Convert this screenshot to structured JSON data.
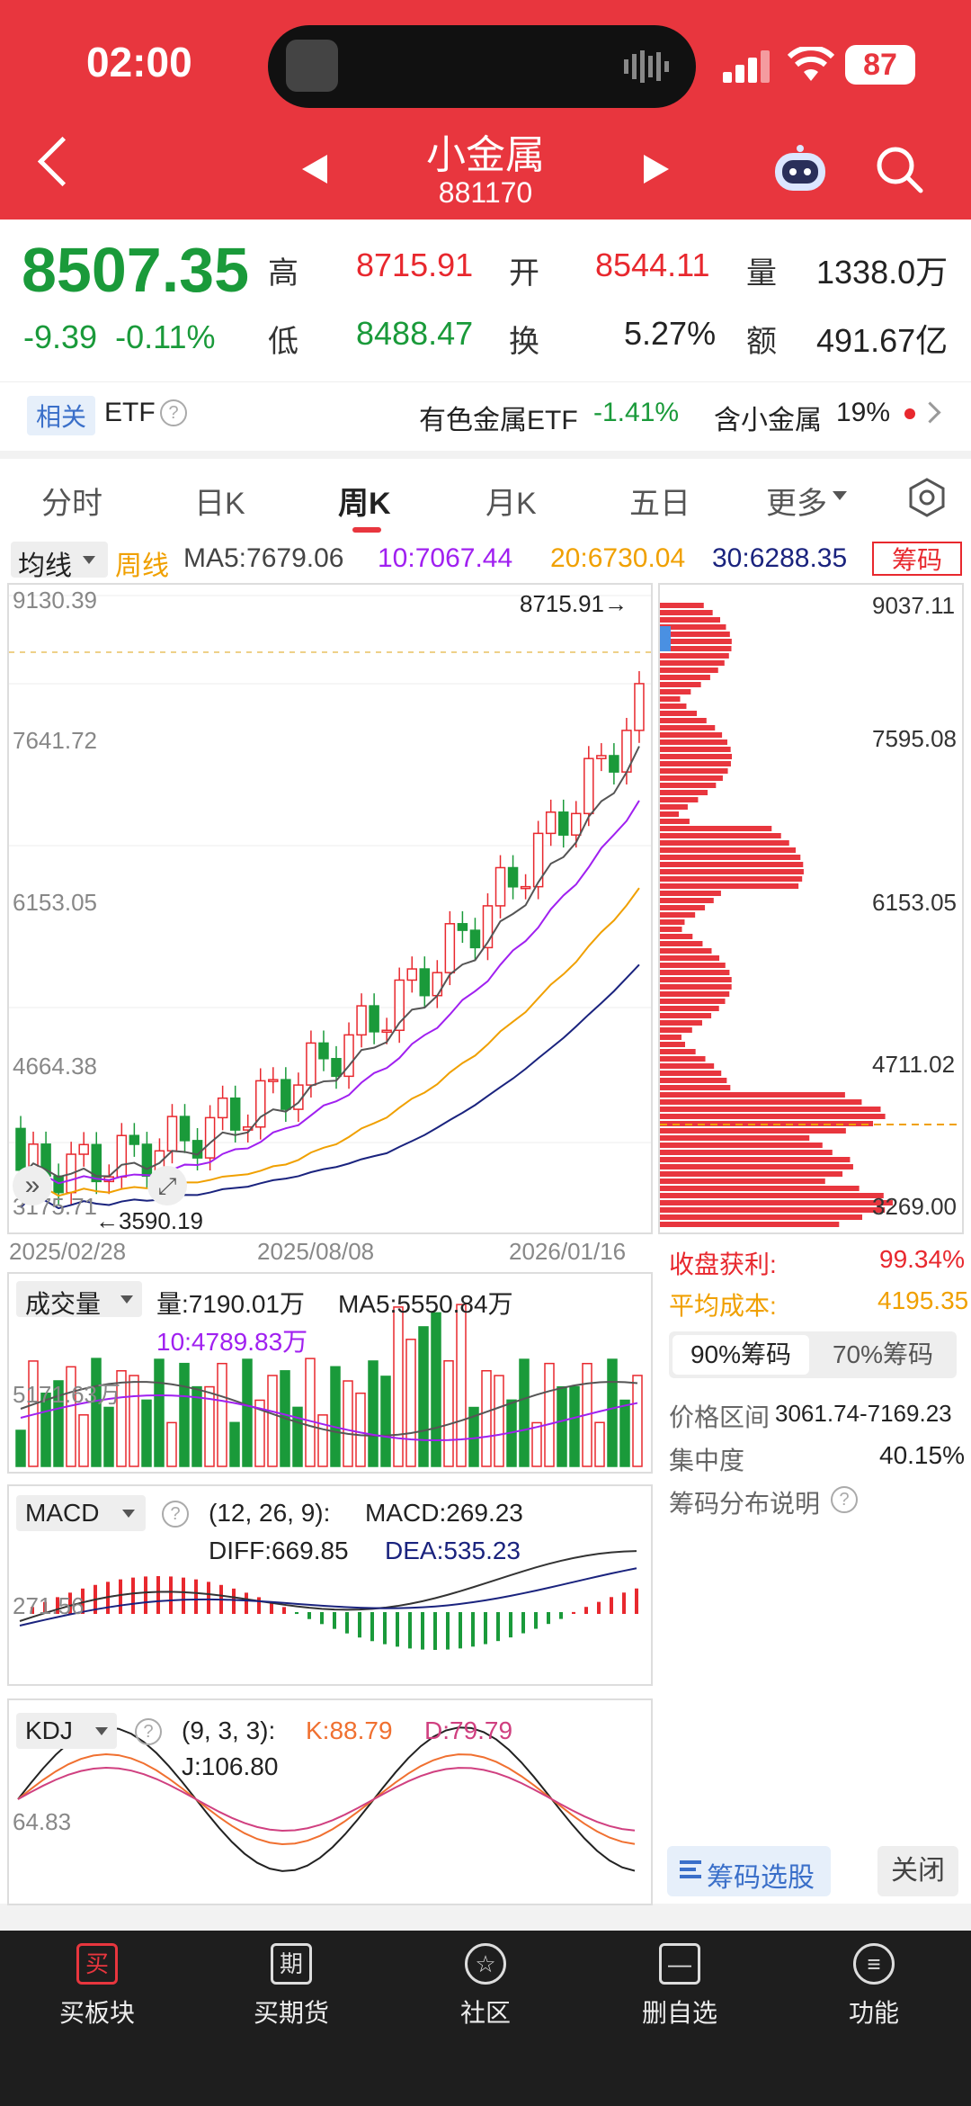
{
  "status": {
    "time": "02:00",
    "battery": "87"
  },
  "header": {
    "title": "小金属",
    "code": "881170"
  },
  "quote": {
    "price": "8507.35",
    "change": "-9.39",
    "change_pct": "-0.11%",
    "high_label": "高",
    "high": "8715.91",
    "low_label": "低",
    "low": "8488.47",
    "open_label": "开",
    "open": "8544.11",
    "turnover_label": "换",
    "turnover": "5.27%",
    "volume_label": "量",
    "volume": "1338.0万",
    "amount_label": "额",
    "amount": "491.67亿"
  },
  "etf_bar": {
    "tag": "相关",
    "etf": "ETF",
    "etf_name": "有色金属ETF",
    "etf_change": "-1.41%",
    "contains_label": "含小金属",
    "contains_pct": "19%"
  },
  "tabs": [
    "分时",
    "日K",
    "周K",
    "月K",
    "五日",
    "更多"
  ],
  "ma_bar": {
    "selector": "均线",
    "period": "周线",
    "ma5": "MA5:7679.06",
    "ma10": "10:7067.44",
    "ma20": "20:6730.04",
    "ma30": "30:6288.35",
    "chips_btn": "筹码"
  },
  "kchart": {
    "y_labels": [
      "9130.39",
      "7641.72",
      "6153.05",
      "4664.38",
      "3175.71"
    ],
    "max_label": "8715.91→",
    "min_label": "←3590.19",
    "dates": [
      "2025/02/28",
      "2025/08/08",
      "2026/01/16"
    ]
  },
  "volume": {
    "selector": "成交量",
    "vol": "量:7190.01万",
    "ma5": "MA5:5550.84万",
    "ma10": "10:4789.83万",
    "axis": "5171.63万"
  },
  "macd": {
    "selector": "MACD",
    "params": "(12, 26, 9):",
    "macd": "MACD:269.23",
    "diff": "DIFF:669.85",
    "dea": "DEA:535.23",
    "axis": "271.56"
  },
  "kdj": {
    "selector": "KDJ",
    "params": "(9, 3, 3):",
    "k": "K:88.79",
    "d": "D:79.79",
    "j": "J:106.80",
    "axis": "64.83"
  },
  "chips": {
    "y_labels": [
      "9037.11",
      "7595.08",
      "6153.05",
      "4711.02",
      "3269.00"
    ],
    "profit_label": "收盘获利:",
    "profit": "99.34%",
    "avg_cost_label": "平均成本:",
    "avg_cost": "4195.35",
    "tab90": "90%筹码",
    "tab70": "70%筹码",
    "range_label": "价格区间",
    "range": "3061.74-7169.23",
    "concentration_label": "集中度",
    "concentration": "40.15%",
    "explain": "筹码分布说明",
    "select_btn": "筹码选股",
    "close_btn": "关闭"
  },
  "bottom_nav": [
    {
      "label": "买板块",
      "icon": "买"
    },
    {
      "label": "买期货",
      "icon": "期"
    },
    {
      "label": "社区",
      "icon": "☆"
    },
    {
      "label": "删自选",
      "icon": "—"
    },
    {
      "label": "功能",
      "icon": "≡"
    }
  ],
  "colors": {
    "brand": "#e8363e",
    "up": "#e8282e",
    "down": "#1a9a3a",
    "ma5": "#555555",
    "ma10": "#a020f0",
    "ma20": "#f0a000",
    "ma30": "#1a237e"
  }
}
